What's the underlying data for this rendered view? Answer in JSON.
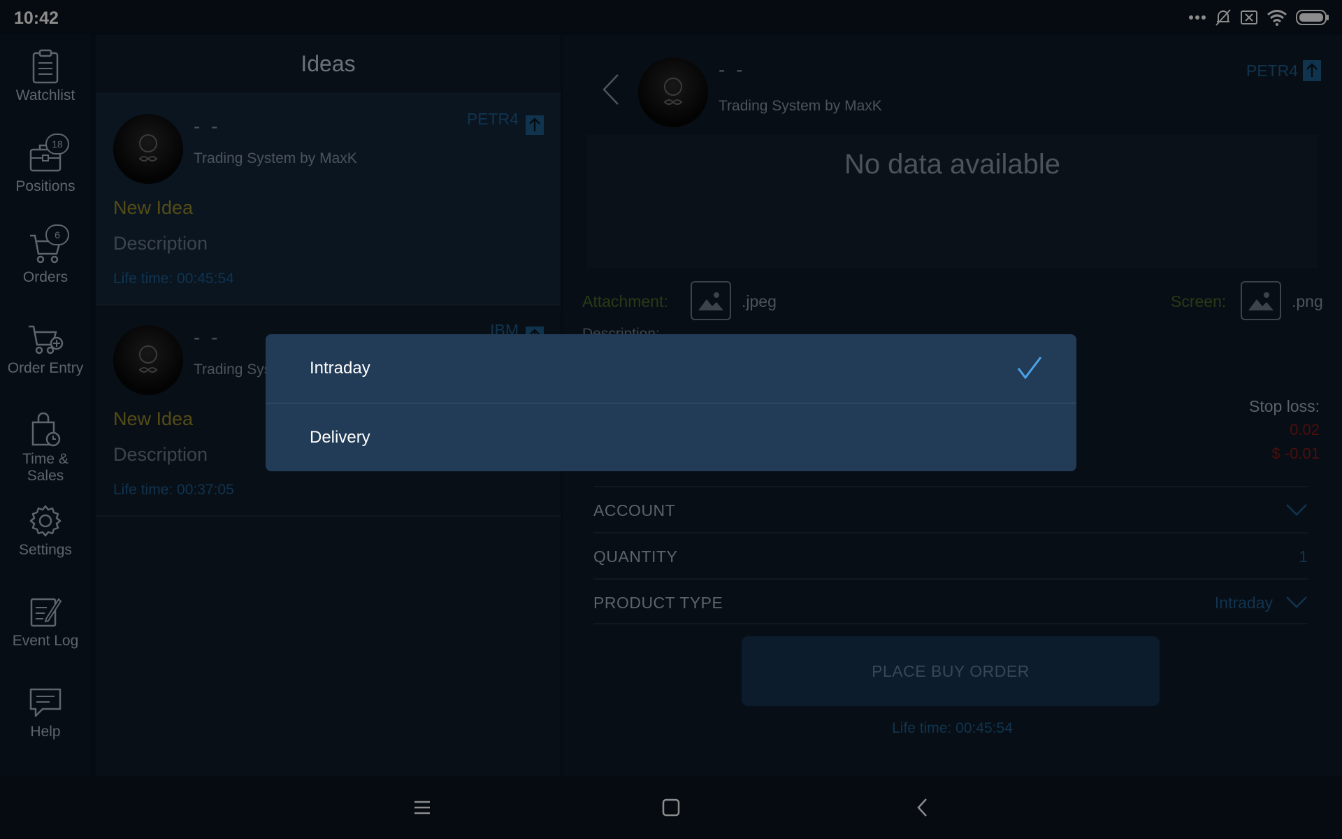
{
  "status_bar": {
    "time": "10:42",
    "icons": [
      "more-dots-icon",
      "bell-off-icon",
      "sim-error-icon",
      "wifi-icon",
      "battery-icon"
    ]
  },
  "sidebar": {
    "items": [
      {
        "label": "Watchlist",
        "icon": "clipboard-icon"
      },
      {
        "label": "Positions",
        "icon": "briefcase-icon",
        "badge": "18"
      },
      {
        "label": "Orders",
        "icon": "cart-icon",
        "badge": "6"
      },
      {
        "label": "Order Entry",
        "icon": "cart-add-icon"
      },
      {
        "label": "Time &\nSales",
        "icon": "bag-clock-icon"
      },
      {
        "label": "Settings",
        "icon": "gear-icon"
      },
      {
        "label": "Event Log",
        "icon": "edit-log-icon"
      },
      {
        "label": "Help",
        "icon": "chat-help-icon"
      }
    ]
  },
  "ideas": {
    "title": "Ideas",
    "cards": [
      {
        "author": "- -",
        "system": "Trading System by MaxK",
        "symbol": "PETR4",
        "name": "New Idea",
        "description": "Description",
        "lifetime": "Life time: 00:45:54"
      },
      {
        "author": "- -",
        "system": "Trading System by MaxK",
        "symbol": "IBM",
        "name": "New Idea",
        "description": "Description",
        "lifetime": "Life time: 00:37:05"
      }
    ]
  },
  "details": {
    "author": "- -",
    "system": "Trading System by MaxK",
    "symbol": "PETR4",
    "chart_message": "No data available",
    "attachment_label": "Attachment:",
    "attachment_ext": ".jpeg",
    "screen_label": "Screen:",
    "screen_ext": ".png",
    "description_label": "Description:",
    "stop_loss_label": "Stop loss:",
    "stop_loss_value": "0.02",
    "stop_loss_amount": "$ -0.01",
    "form": {
      "account_label": "ACCOUNT",
      "account_value": "",
      "quantity_label": "QUANTITY",
      "quantity_value": "1",
      "product_type_label": "PRODUCT TYPE",
      "product_type_value": "Intraday"
    },
    "buy_button": "PLACE BUY ORDER",
    "lifetime": "Life time: 00:45:54"
  },
  "popup": {
    "options": [
      {
        "label": "Intraday",
        "selected": true
      },
      {
        "label": "Delivery",
        "selected": false
      }
    ]
  },
  "colors": {
    "background": "#0b1420",
    "popup_bg": "#223b57",
    "accent_blue": "#1e5f92",
    "check_blue": "#4aa3e6",
    "idea_name": "#9a8a2a",
    "stop_loss": "#8a1b1b"
  }
}
